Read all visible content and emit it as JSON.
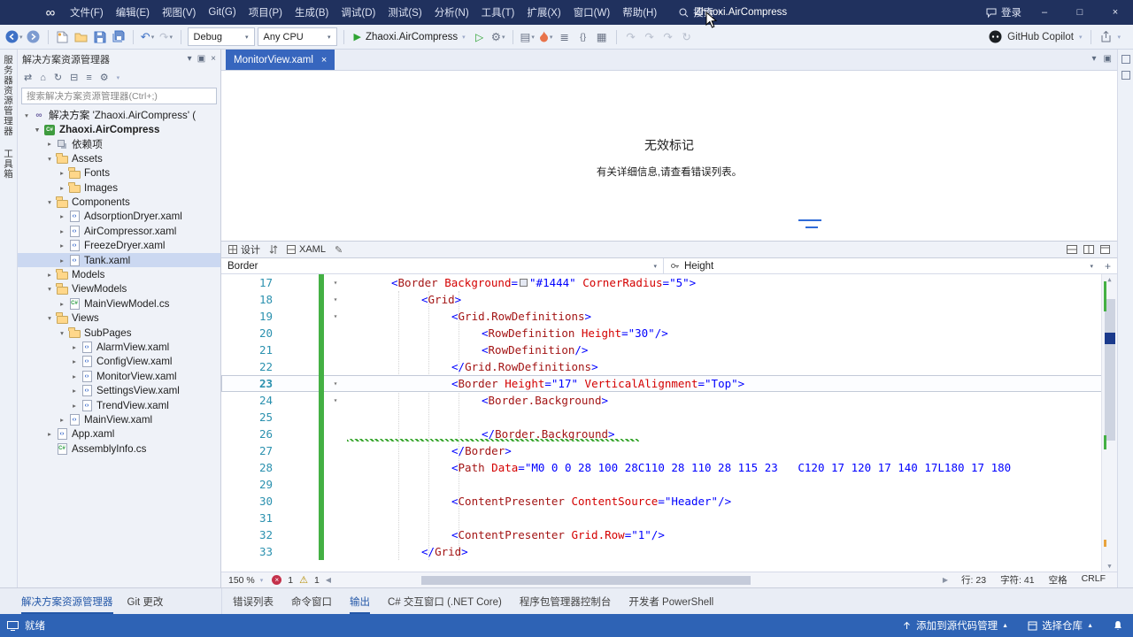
{
  "titlebar": {
    "menus": [
      "文件(F)",
      "编辑(E)",
      "视图(V)",
      "Git(G)",
      "项目(P)",
      "生成(B)",
      "调试(D)",
      "测试(S)",
      "分析(N)",
      "工具(T)",
      "扩展(X)",
      "窗口(W)",
      "帮助(H)"
    ],
    "search_label": "搜索",
    "title": "Zhaoxi.AirCompress",
    "signin_label": "登录"
  },
  "toolbar": {
    "config_combo": "Debug",
    "platform_combo": "Any CPU",
    "run_label": "Zhaoxi.AirCompress",
    "copilot_label": "GitHub Copilot"
  },
  "activity_strip": {
    "tabs": [
      "服务器资源管理器",
      "工具箱"
    ]
  },
  "solution_explorer": {
    "title": "解决方案资源管理器",
    "search_placeholder": "搜索解决方案资源管理器(Ctrl+;)",
    "tree": [
      {
        "label": "解决方案 'Zhaoxi.AirCompress' ("
      },
      {
        "label": "Zhaoxi.AirCompress"
      },
      {
        "label": "依赖项"
      },
      {
        "label": "Assets"
      },
      {
        "label": "Fonts"
      },
      {
        "label": "Images"
      },
      {
        "label": "Components"
      },
      {
        "label": "AdsorptionDryer.xaml"
      },
      {
        "label": "AirCompressor.xaml"
      },
      {
        "label": "FreezeDryer.xaml"
      },
      {
        "label": "Tank.xaml"
      },
      {
        "label": "Models"
      },
      {
        "label": "ViewModels"
      },
      {
        "label": "MainViewModel.cs"
      },
      {
        "label": "Views"
      },
      {
        "label": "SubPages"
      },
      {
        "label": "AlarmView.xaml"
      },
      {
        "label": "ConfigView.xaml"
      },
      {
        "label": "MonitorView.xaml"
      },
      {
        "label": "SettingsView.xaml"
      },
      {
        "label": "TrendView.xaml"
      },
      {
        "label": "MainView.xaml"
      },
      {
        "label": "App.xaml"
      },
      {
        "label": "AssemblyInfo.cs"
      }
    ],
    "bottom_tabs": [
      "解决方案资源管理器",
      "Git 更改"
    ]
  },
  "editor": {
    "tab_label": "MonitorView.xaml",
    "designer_title": "无效标记",
    "designer_subtitle": "有关详细信息,请查看错误列表。",
    "design_label": "设计",
    "xaml_label": "XAML",
    "breadcrumb_element": "Border",
    "breadcrumb_property": "Height",
    "zoom": "150 %",
    "error_count": "1",
    "warning_count": "1",
    "line_label": "行: 23",
    "column_label": "字符: 41",
    "space_label": "空格",
    "eol_label": "CRLF"
  },
  "code": {
    "numbers": [
      "17",
      "18",
      "19",
      "20",
      "21",
      "22",
      "23",
      "24",
      "25",
      "26",
      "27",
      "28",
      "29",
      "30",
      "31",
      "32",
      "33"
    ],
    "l17": [
      "<",
      "Border",
      " Background",
      "=",
      "\"#1444\"",
      " CornerRadius",
      "=",
      "\"5\"",
      ">"
    ],
    "l18": [
      "<",
      "Grid",
      ">"
    ],
    "l19": [
      "<",
      "Grid.RowDefinitions",
      ">"
    ],
    "l20": [
      "<",
      "RowDefinition",
      " Height",
      "=",
      "\"30\"",
      "/>"
    ],
    "l21": [
      "<",
      "RowDefinition",
      "/>"
    ],
    "l22": [
      "</",
      "Grid.RowDefinitions",
      ">"
    ],
    "l23": [
      "<",
      "Border",
      " Height",
      "=",
      "\"17\"",
      " VerticalAlignment",
      "=",
      "\"Top\"",
      ">"
    ],
    "l24": [
      "<",
      "Border.Background",
      ">"
    ],
    "l26": [
      "</",
      "Border.Background",
      ">"
    ],
    "l27": [
      "</",
      "Border",
      ">"
    ],
    "l28": [
      "<",
      "Path",
      " Data",
      "=",
      "\"M0 0 0 28 100 28C110 28 110 28 115 23   C120 17 120 17 140 17L180 17 180"
    ],
    "l30": [
      "<",
      "ContentPresenter",
      " ContentSource",
      "=",
      "\"Header\"",
      "/>"
    ],
    "l32": [
      "<",
      "ContentPresenter",
      " Grid.Row",
      "=",
      "\"1\"",
      "/>"
    ],
    "l33": [
      "</",
      "Grid",
      ">"
    ]
  },
  "bottom_panel": {
    "tabs": [
      "错误列表",
      "命令窗口",
      "输出",
      "C# 交互窗口 (.NET Core)",
      "程序包管理器控制台",
      "开发者 PowerShell"
    ]
  },
  "statusbar": {
    "ready_label": "就绪",
    "add_source_label": "添加到源代码管理",
    "select_repo_label": "选择仓库"
  }
}
